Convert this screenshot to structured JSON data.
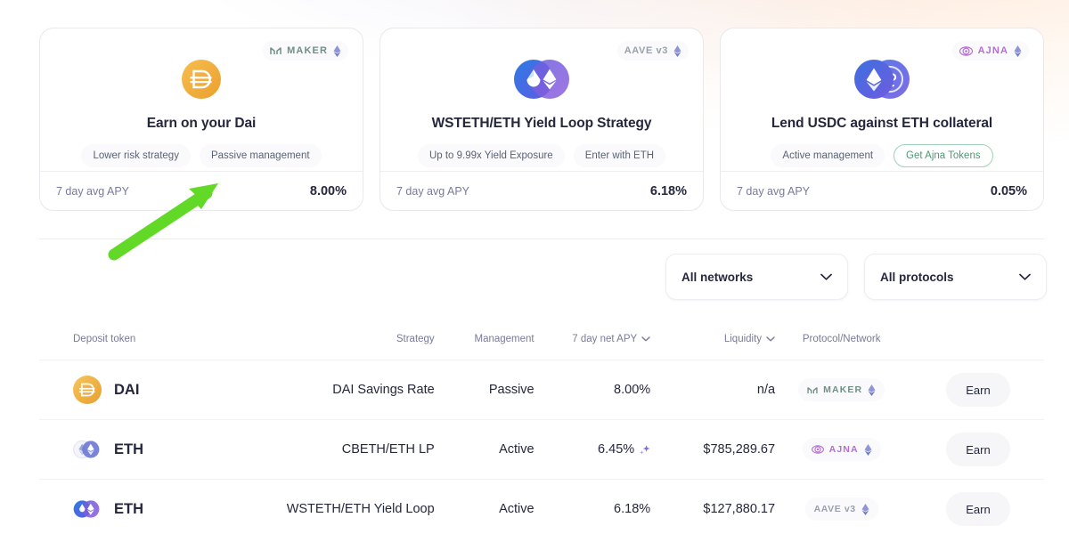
{
  "promo_cards": [
    {
      "protocol": "MAKER",
      "protocol_icon": "maker-logo-icon",
      "network_icon": "ethereum-icon",
      "token_icon": "dai-token-icon",
      "title": "Earn on your Dai",
      "pills": [
        {
          "label": "Lower risk strategy",
          "style": "filled"
        },
        {
          "label": "Passive management",
          "style": "filled"
        }
      ],
      "footer_label": "7 day avg APY",
      "footer_value": "8.00%"
    },
    {
      "protocol": "AAVE v3",
      "protocol_icon": "aave-logo-icon",
      "network_icon": "ethereum-icon",
      "token_icon": "wsteth-eth-pair-icon",
      "title": "WSTETH/ETH Yield Loop Strategy",
      "pills": [
        {
          "label": "Up to 9.99x Yield Exposure",
          "style": "filled"
        },
        {
          "label": "Enter with ETH",
          "style": "filled"
        }
      ],
      "footer_label": "7 day avg APY",
      "footer_value": "6.18%"
    },
    {
      "protocol": "AJNA",
      "protocol_icon": "ajna-logo-icon",
      "network_icon": "ethereum-icon",
      "token_icon": "eth-usdc-pair-icon",
      "title": "Lend USDC against ETH collateral",
      "pills": [
        {
          "label": "Active management",
          "style": "filled"
        },
        {
          "label": "Get Ajna Tokens",
          "style": "outline"
        }
      ],
      "footer_label": "7 day avg APY",
      "footer_value": "0.05%"
    }
  ],
  "filters": [
    {
      "label": "All networks",
      "icon": "chevron-down-icon"
    },
    {
      "label": "All protocols",
      "icon": "chevron-down-icon"
    }
  ],
  "table": {
    "headers": {
      "token": "Deposit token",
      "strategy": "Strategy",
      "management": "Management",
      "apy": "7 day net APY",
      "liquidity": "Liquidity",
      "protocol": "Protocol/Network",
      "action": ""
    },
    "sortable": {
      "apy_icon": "chevron-down-icon",
      "liquidity_icon": "chevron-down-icon"
    },
    "rows": [
      {
        "token": "DAI",
        "token_icon": "dai-token-icon",
        "strategy": "DAI Savings Rate",
        "management": "Passive",
        "apy": "8.00%",
        "apy_badge": "",
        "liquidity": "n/a",
        "protocol": "MAKER",
        "protocol_icon": "maker-logo-icon",
        "network_icon": "ethereum-icon",
        "action": "Earn"
      },
      {
        "token": "ETH",
        "token_icon": "cbeth-eth-pair-icon",
        "strategy": "CBETH/ETH LP",
        "management": "Active",
        "apy": "6.45%",
        "apy_badge": "sparkle-icon",
        "liquidity": "$785,289.67",
        "protocol": "AJNA",
        "protocol_icon": "ajna-logo-icon",
        "network_icon": "ethereum-icon",
        "action": "Earn"
      },
      {
        "token": "ETH",
        "token_icon": "wsteth-eth-pair-icon",
        "strategy": "WSTETH/ETH Yield Loop",
        "management": "Active",
        "apy": "6.18%",
        "apy_badge": "",
        "liquidity": "$127,880.17",
        "protocol": "AAVE v3",
        "protocol_icon": "aave-logo-icon",
        "network_icon": "ethereum-icon",
        "action": "Earn"
      }
    ]
  },
  "annotation": {
    "type": "arrow",
    "color": "#63d927",
    "points_to": "8.00% avg APY on Earn on your Dai card"
  },
  "colors": {
    "text_primary": "#25273d",
    "text_muted": "#787a9b",
    "card_border": "#e8e8ed",
    "pill_bg": "#fafafc",
    "accent_green": "#4a9a72",
    "dai_yellow": "#f5ac37",
    "arrow_green": "#63d927"
  }
}
